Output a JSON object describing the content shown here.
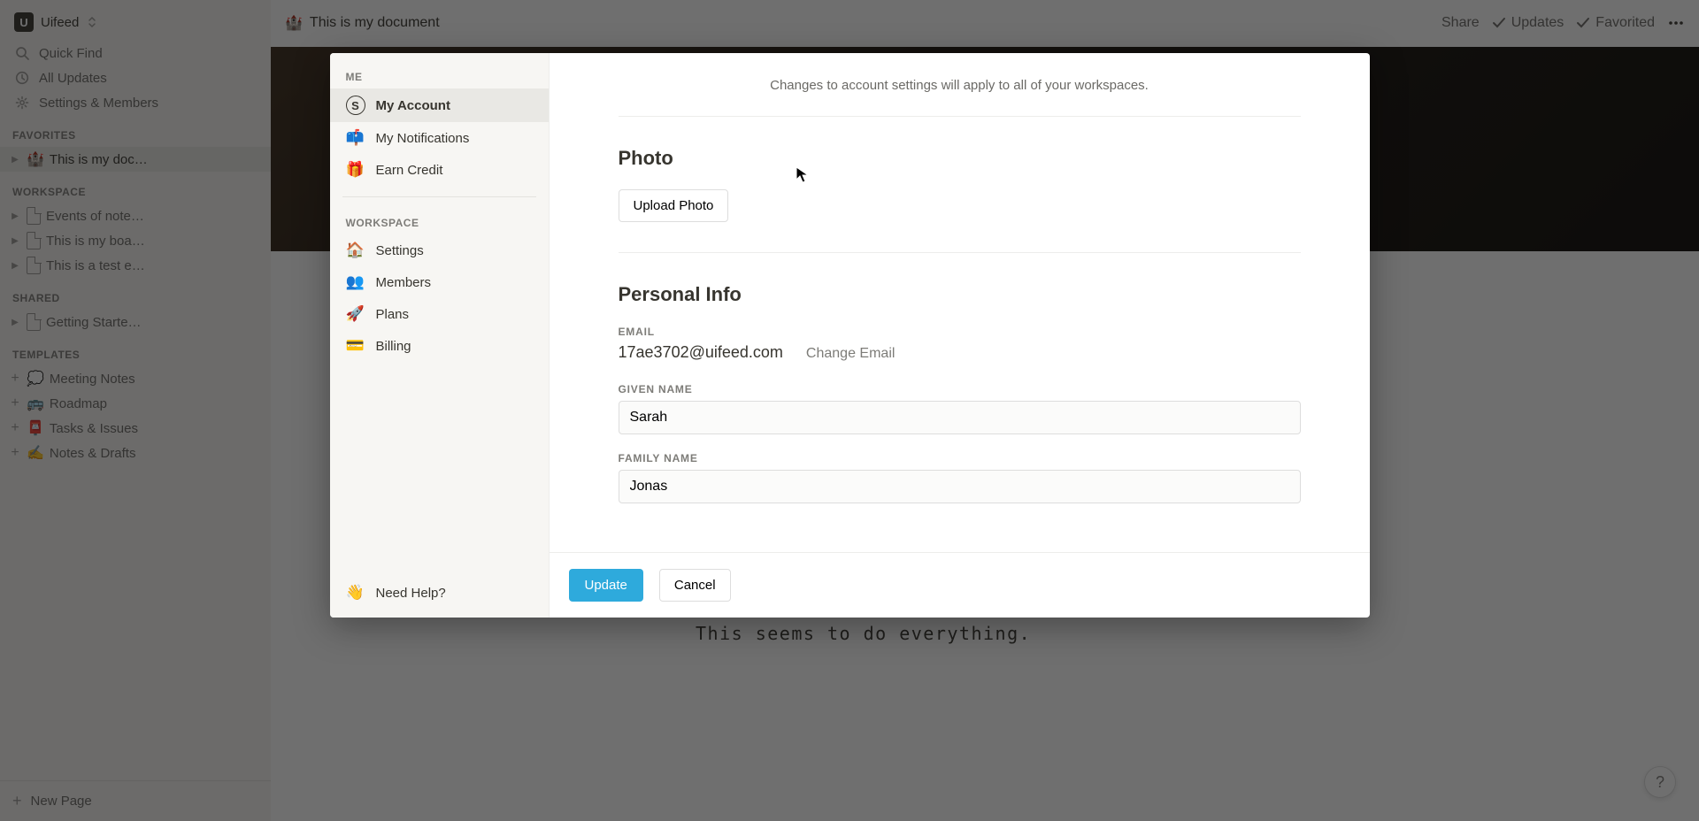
{
  "workspace": {
    "initial": "U",
    "name": "Uifeed"
  },
  "sidebar": {
    "quick_find": "Quick Find",
    "all_updates": "All Updates",
    "settings_members": "Settings & Members",
    "favorites_heading": "FAVORITES",
    "fav_doc": {
      "emoji": "🏰",
      "title": "This is my doc…"
    },
    "workspace_heading": "WORKSPACE",
    "pages": [
      {
        "title": "Events of note…"
      },
      {
        "title": "This is my boa…"
      },
      {
        "title": "This is a test e…"
      }
    ],
    "shared_heading": "SHARED",
    "shared_page": "Getting Starte…",
    "templates_heading": "TEMPLATES",
    "templates": [
      {
        "emoji": "💭",
        "title": "Meeting Notes"
      },
      {
        "emoji": "🚌",
        "title": "Roadmap"
      },
      {
        "emoji": "📮",
        "title": "Tasks & Issues"
      },
      {
        "emoji": "✍️",
        "title": "Notes & Drafts"
      }
    ],
    "new_page": "New Page"
  },
  "topbar": {
    "emoji": "🏰",
    "title": "This is my document",
    "share": "Share",
    "updates": "Updates",
    "favorited": "Favorited"
  },
  "doc": {
    "line": "This seems to do everything."
  },
  "modal": {
    "side": {
      "me_heading": "ME",
      "my_account": "My Account",
      "my_notifications": "My Notifications",
      "earn_credit": "Earn Credit",
      "workspace_heading": "WORKSPACE",
      "settings": "Settings",
      "members": "Members",
      "plans": "Plans",
      "billing": "Billing",
      "need_help": "Need Help?"
    },
    "body": {
      "hint": "Changes to account settings will apply to all of your workspaces.",
      "photo_heading": "Photo",
      "upload_photo": "Upload Photo",
      "personal_heading": "Personal Info",
      "email_label": "EMAIL",
      "email_value": "17ae3702@uifeed.com",
      "change_email": "Change Email",
      "given_label": "GIVEN NAME",
      "given_value": "Sarah",
      "family_label": "FAMILY NAME",
      "family_value": "Jonas",
      "update_btn": "Update",
      "cancel_btn": "Cancel"
    }
  },
  "help_fab": "?"
}
